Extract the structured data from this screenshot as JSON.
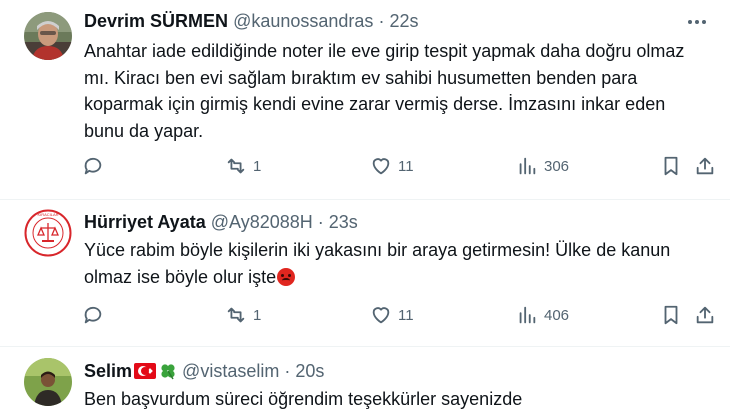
{
  "tweets": [
    {
      "name": "Devrim SÜRMEN",
      "handle": "@kaunossandras",
      "separator": "·",
      "time": "22s",
      "text": "Anahtar iade edildiğinde noter ile eve girip tespit yapmak daha doğru olmaz mı. Kiracı ben evi sağlam bıraktım ev sahibi husumetten benden para koparmak için girmiş kendi evine zarar vermiş derse. İmzasını inkar eden bunu da yapar.",
      "replies": "",
      "retweets": "1",
      "likes": "11",
      "views": "306"
    },
    {
      "name": "Hürriyet Ayata",
      "handle": "@Ay82088H",
      "separator": "·",
      "time": "23s",
      "text": "Yüce rabim böyle kişilerin iki yakasını bir araya getirmesin! Ülke de kanun olmaz ise böyle olur işte",
      "emoji": "angry-face-emoji",
      "avatar_text": "KİRACILAR",
      "replies": "",
      "retweets": "1",
      "likes": "11",
      "views": "406"
    },
    {
      "name": "Selim",
      "name_icons": [
        "turkey-flag-icon",
        "four-leaf-clover-icon"
      ],
      "handle": "@vistaselim",
      "separator": "·",
      "time": "20s",
      "text": "Ben başvurdum süreci öğrendim teşekkürler sayenizde"
    }
  ],
  "colors": {
    "text": "#0f1419",
    "secondary": "#536471",
    "divider": "#eff3f4"
  }
}
